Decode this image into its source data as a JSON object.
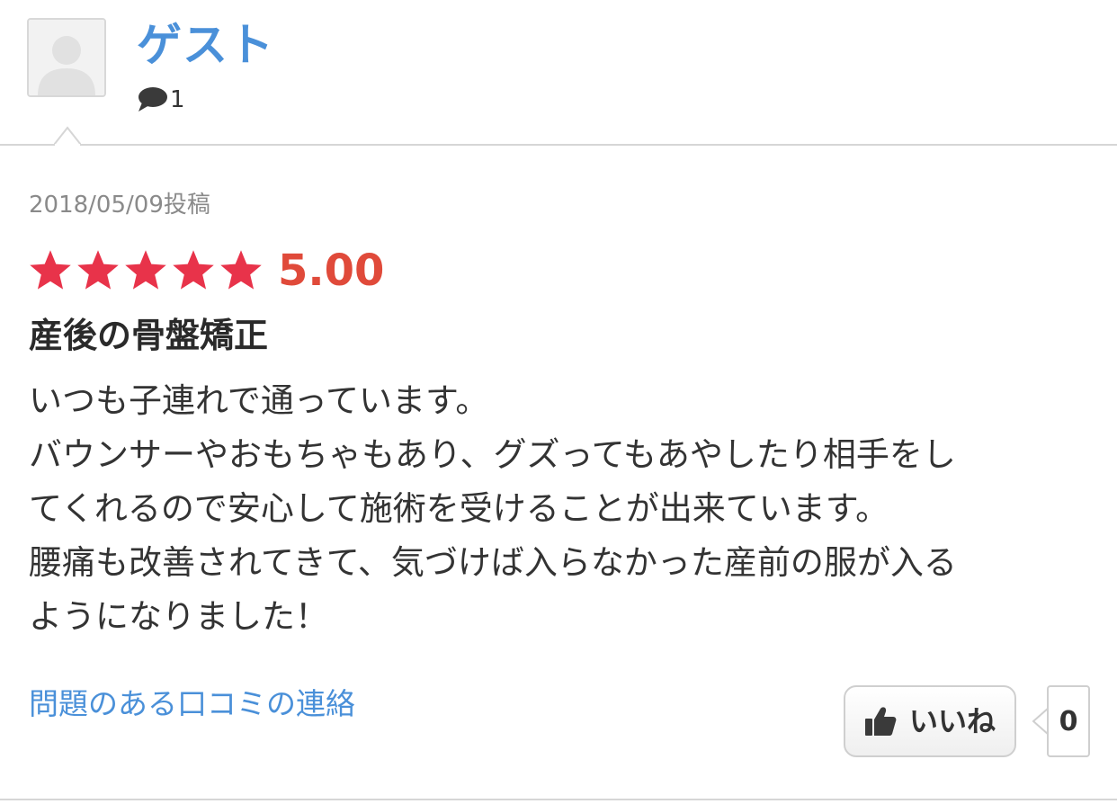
{
  "user": {
    "name": "ゲスト",
    "comment_count": "1"
  },
  "review": {
    "date": "2018/05/09投稿",
    "rating": {
      "value": 5.0,
      "label": "5.00",
      "max": 5,
      "star_color": "#e8334a",
      "value_color": "#e04a3a"
    },
    "title": "産後の骨盤矯正",
    "body_lines": [
      "いつも子連れで通っています。",
      "バウンサーやおもちゃもあり、グズってもあやしたり相手をし",
      "てくれるので安心して施術を受けることが出来ています。",
      "腰痛も改善されてきて、気づけば入らなかった産前の服が入る",
      "ようになりました！"
    ]
  },
  "actions": {
    "report_link": "問題のある口コミの連絡",
    "like_label": "いいね",
    "like_count": "0"
  },
  "icons": {
    "avatar": "default-avatar-icon",
    "comment": "speech-bubble-icon",
    "star": "star-icon",
    "like": "thumbs-up-icon"
  },
  "colors": {
    "link": "#4a90d9",
    "text": "#333333",
    "muted": "#8a8a8a",
    "divider": "#d6d6d6"
  }
}
